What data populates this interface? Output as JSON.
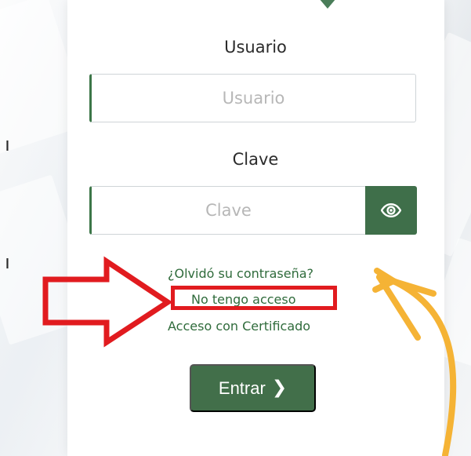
{
  "form": {
    "username_label": "Usuario",
    "username_placeholder": "Usuario",
    "password_label": "Clave",
    "password_placeholder": "Clave",
    "show_password_icon": "eye-icon",
    "forgot_password_link": "¿Olvidó su contraseña?",
    "no_access_link": "No tengo acceso",
    "certificate_access_link": "Acceso con Certificado",
    "submit_label": "Entrar",
    "submit_icon": "chevron-right-icon"
  },
  "colors": {
    "primary_green": "#426f4a",
    "link_green": "#2f6b3b",
    "annotation_red": "#e11b1f",
    "annotation_orange": "#f5b335"
  }
}
